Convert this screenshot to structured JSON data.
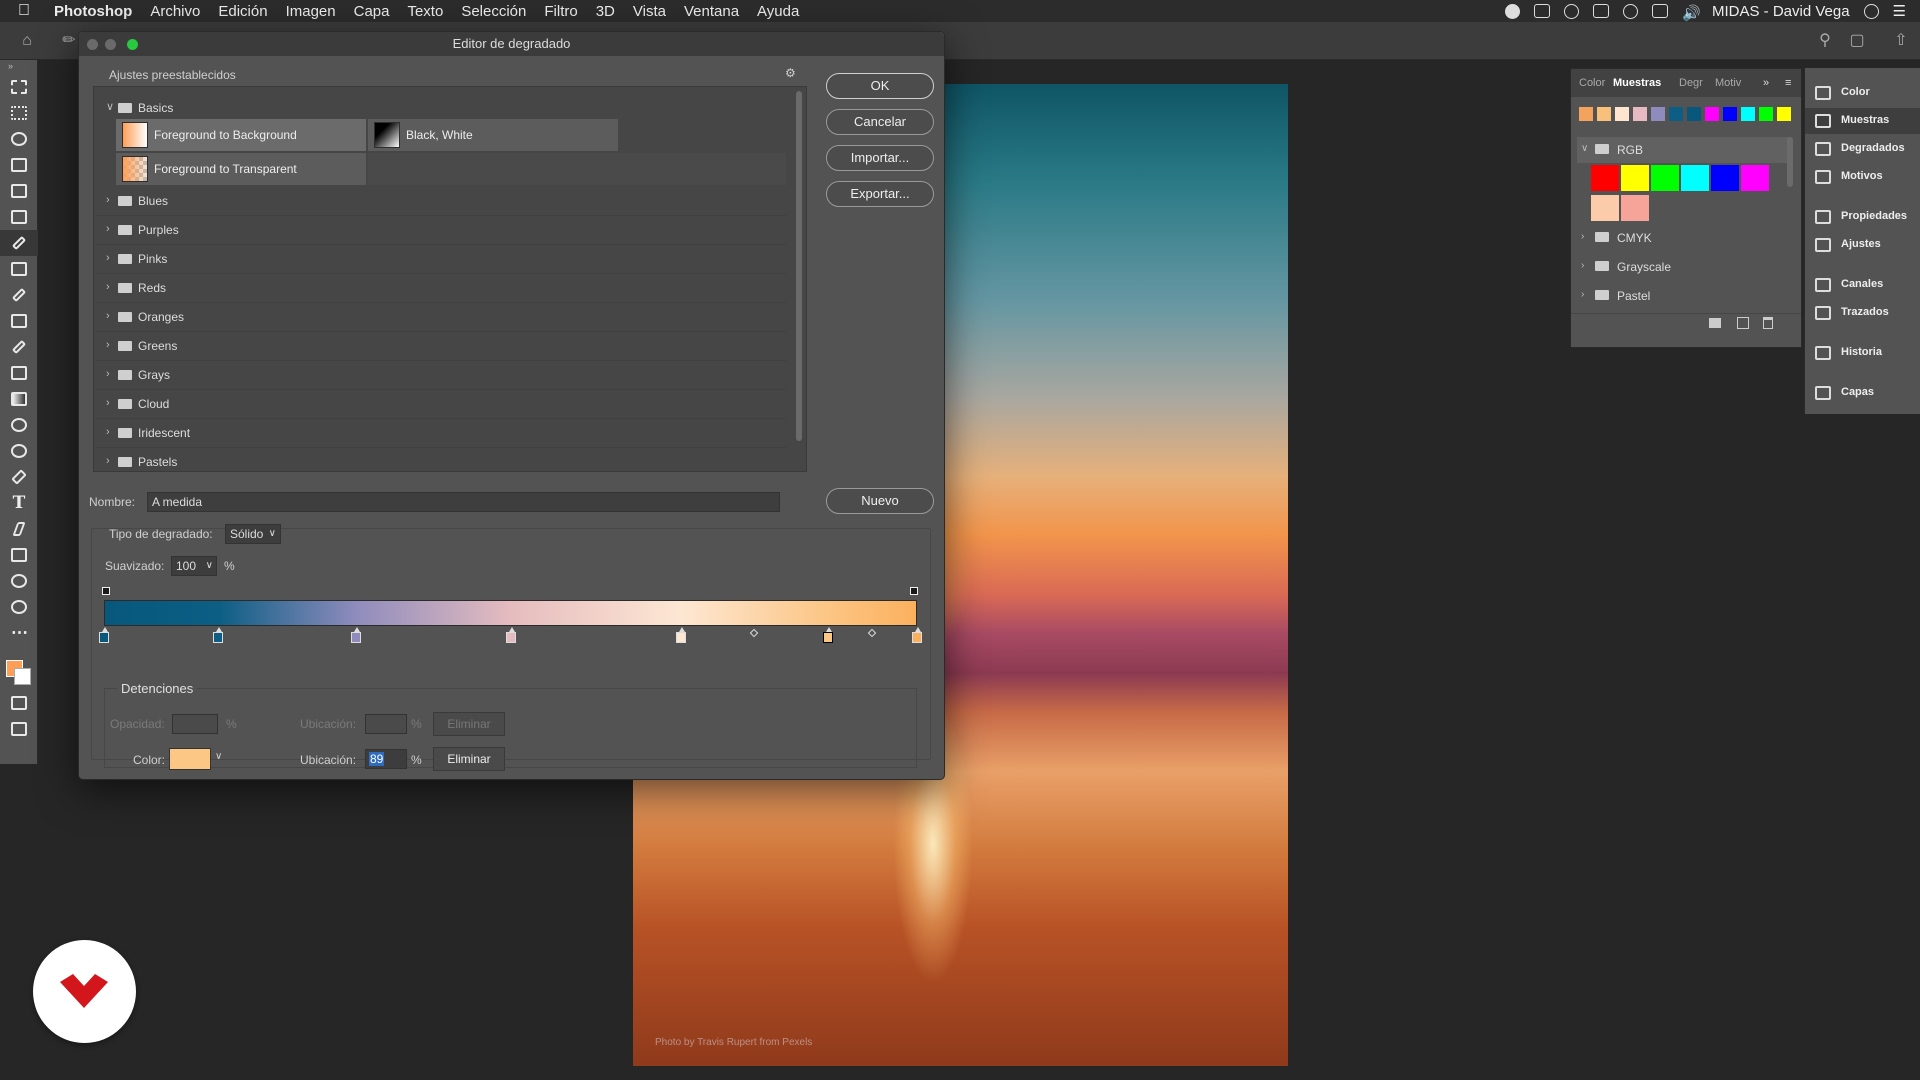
{
  "menubar": {
    "app_name": "Photoshop",
    "menus": [
      "Archivo",
      "Edición",
      "Imagen",
      "Capa",
      "Texto",
      "Selección",
      "Filtro",
      "3D",
      "Vista",
      "Ventana",
      "Ayuda"
    ],
    "user": "MIDAS - David Vega"
  },
  "document": {
    "credit": "Photo by Travis Rupert from Pexels"
  },
  "dialog": {
    "title": "Editor de degradado",
    "presets_label": "Ajustes preestablecidos",
    "basics_label": "Basics",
    "basics_items": [
      {
        "label": "Foreground to Background",
        "selected": true
      },
      {
        "label": "Black, White",
        "selected": false
      },
      {
        "label": "Foreground to Transparent",
        "selected": false
      }
    ],
    "folders": [
      "Blues",
      "Purples",
      "Pinks",
      "Reds",
      "Oranges",
      "Greens",
      "Grays",
      "Cloud",
      "Iridescent",
      "Pastels"
    ],
    "buttons": {
      "ok": "OK",
      "cancel": "Cancelar",
      "import": "Importar...",
      "export": "Exportar...",
      "new": "Nuevo"
    },
    "name_label": "Nombre:",
    "name_value": "A medida",
    "type_label": "Tipo de degradado:",
    "type_value": "Sólido",
    "smooth_label": "Suavizado:",
    "smooth_value": "100",
    "percent": "%",
    "stops_label": "Detenciones",
    "opacity_label": "Opacidad:",
    "location_label": "Ubicación:",
    "delete_label": "Eliminar",
    "color_label": "Color:",
    "location_value": "89",
    "color_stops": [
      {
        "location": 0,
        "color": "#07587c"
      },
      {
        "location": 14,
        "color": "#0c5e84"
      },
      {
        "location": 31,
        "color": "#8f8cbd"
      },
      {
        "location": 50,
        "color": "#e5bcbf"
      },
      {
        "location": 71,
        "color": "#fde7d3"
      },
      {
        "location": 89,
        "color": "#fcc685"
      },
      {
        "location": 100,
        "color": "#fbb05e"
      }
    ],
    "selected_color": "#fcc685"
  },
  "swatches": {
    "tabs": [
      "Color",
      "Muestras",
      "Degr",
      "Motiv"
    ],
    "active_tab": "Muestras",
    "recent": [
      "#f4a35c",
      "#f9c07c",
      "#fde5d0",
      "#e6bac0",
      "#8f8cbd",
      "#0c5e84",
      "#07587c",
      "#ff00ff",
      "#0000ff",
      "#00ffff",
      "#00ff00",
      "#ffff00"
    ],
    "groups": [
      {
        "name": "RGB",
        "expanded": true,
        "colors": [
          "#ff0000",
          "#ffff00",
          "#00ff00",
          "#00ffff",
          "#0000ff",
          "#ff00ff",
          "#fccbaa",
          "#f6a49a"
        ]
      },
      {
        "name": "CMYK",
        "expanded": false
      },
      {
        "name": "Grayscale",
        "expanded": false
      },
      {
        "name": "Pastel",
        "expanded": false
      }
    ]
  },
  "dock": {
    "items": [
      "Color",
      "Muestras",
      "Degradados",
      "Motivos",
      "Propiedades",
      "Ajustes",
      "Canales",
      "Trazados",
      "Historia",
      "Capas"
    ],
    "active": "Muestras"
  }
}
